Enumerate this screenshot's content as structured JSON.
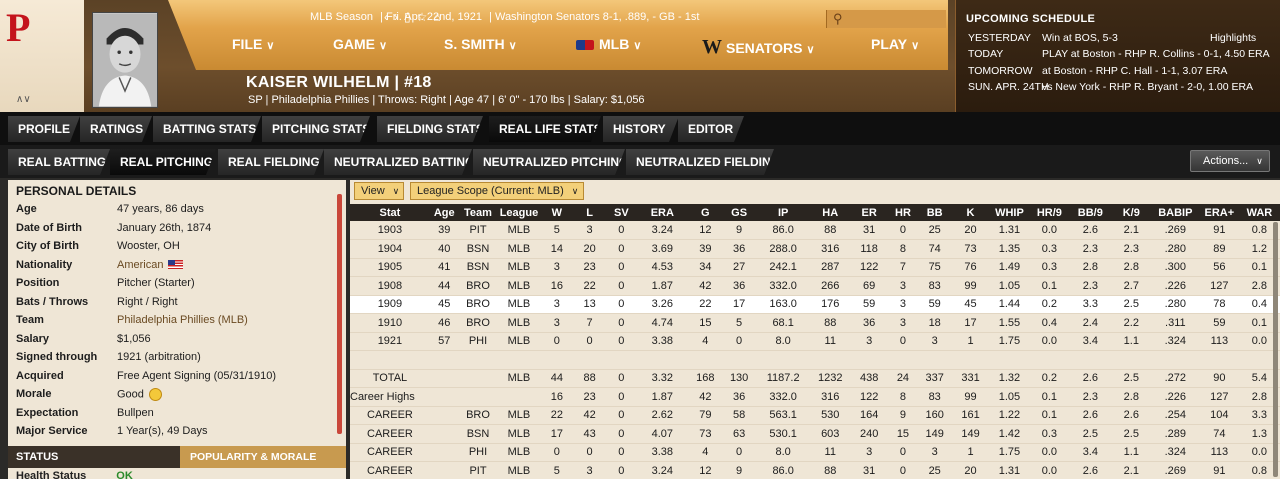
{
  "header": {
    "season": "MLB Season",
    "date": "Fri. Apr. 22nd, 1921",
    "team_record": "Washington Senators  8-1, .889, - GB - 1st",
    "menu": [
      {
        "label": "FILE"
      },
      {
        "label": "GAME"
      },
      {
        "label": "S. SMITH"
      },
      {
        "label": "MLB"
      },
      {
        "label": "SENATORS"
      },
      {
        "label": "PLAY"
      }
    ],
    "player_name": "KAISER WILHELM  |  #18",
    "player_info": "SP | Philadelphia Phillies  |  Throws: Right  |  Age 47  |  6' 0\" - 170 lbs  |  Salary: $1,056"
  },
  "schedule": {
    "title": "UPCOMING SCHEDULE",
    "rows": [
      {
        "day": "YESTERDAY",
        "text": "Win at BOS, 5-3",
        "extra": "Highlights"
      },
      {
        "day": "TODAY",
        "text": "PLAY at Boston - RHP R. Collins - 0-1, 4.50 ERA",
        "extra": ""
      },
      {
        "day": "TOMORROW",
        "text": "at Boston - RHP C. Hall - 1-1, 3.07 ERA",
        "extra": ""
      },
      {
        "day": "SUN. APR. 24TH",
        "text": "vs New York - RHP R. Bryant - 2-0, 1.00 ERA",
        "extra": ""
      }
    ]
  },
  "tabs_main": [
    "PROFILE",
    "RATINGS",
    "BATTING STATS",
    "PITCHING STATS",
    "FIELDING STATS",
    "REAL LIFE STATS",
    "HISTORY",
    "EDITOR"
  ],
  "tabs_sub": [
    "REAL BATTING",
    "REAL PITCHING",
    "REAL FIELDING",
    "NEUTRALIZED BATTING",
    "NEUTRALIZED PITCHING",
    "NEUTRALIZED FIELDING"
  ],
  "actions_label": "Actions...",
  "personal": {
    "title": "PERSONAL DETAILS",
    "rows": [
      {
        "label": "Age",
        "value": "47 years, 86 days"
      },
      {
        "label": "Date of Birth",
        "value": "January 26th, 1874"
      },
      {
        "label": "City of Birth",
        "value": "Wooster, OH"
      },
      {
        "label": "Nationality",
        "value": "American"
      },
      {
        "label": "Position",
        "value": "Pitcher (Starter)"
      },
      {
        "label": "Bats / Throws",
        "value": "Right / Right"
      },
      {
        "label": "Team",
        "value": "Philadelphia Phillies (MLB)"
      },
      {
        "label": "Salary",
        "value": "$1,056"
      },
      {
        "label": "Signed through",
        "value": "1921 (arbitration)"
      },
      {
        "label": "Acquired",
        "value": "Free Agent Signing (05/31/1910)"
      },
      {
        "label": "Morale",
        "value": "Good"
      },
      {
        "label": "Expectation",
        "value": "Bullpen"
      },
      {
        "label": "Major Service",
        "value": "1 Year(s), 49 Days"
      }
    ],
    "status_title": "STATUS",
    "popularity_tab": "POPULARITY & MORALE",
    "health_label": "Health Status",
    "health_value": "OK"
  },
  "filters": {
    "view": "View",
    "scope": "League Scope (Current: MLB)"
  },
  "table": {
    "headers": [
      "Stat",
      "Age",
      "Team",
      "League",
      "W",
      "L",
      "SV",
      "ERA",
      "G",
      "GS",
      "IP",
      "HA",
      "ER",
      "HR",
      "BB",
      "K",
      "WHIP",
      "HR/9",
      "BB/9",
      "K/9",
      "BABIP",
      "ERA+",
      "WAR"
    ],
    "rows": [
      [
        "1903",
        "39",
        "PIT",
        "MLB",
        "5",
        "3",
        "0",
        "3.24",
        "12",
        "9",
        "86.0",
        "88",
        "31",
        "0",
        "25",
        "20",
        "1.31",
        "0.0",
        "2.6",
        "2.1",
        ".269",
        "91",
        "0.8"
      ],
      [
        "1904",
        "40",
        "BSN",
        "MLB",
        "14",
        "20",
        "0",
        "3.69",
        "39",
        "36",
        "288.0",
        "316",
        "118",
        "8",
        "74",
        "73",
        "1.35",
        "0.3",
        "2.3",
        "2.3",
        ".280",
        "89",
        "1.2"
      ],
      [
        "1905",
        "41",
        "BSN",
        "MLB",
        "3",
        "23",
        "0",
        "4.53",
        "34",
        "27",
        "242.1",
        "287",
        "122",
        "7",
        "75",
        "76",
        "1.49",
        "0.3",
        "2.8",
        "2.8",
        ".300",
        "56",
        "0.1"
      ],
      [
        "1908",
        "44",
        "BRO",
        "MLB",
        "16",
        "22",
        "0",
        "1.87",
        "42",
        "36",
        "332.0",
        "266",
        "69",
        "3",
        "83",
        "99",
        "1.05",
        "0.1",
        "2.3",
        "2.7",
        ".226",
        "127",
        "2.8"
      ],
      [
        "1909",
        "45",
        "BRO",
        "MLB",
        "3",
        "13",
        "0",
        "3.26",
        "22",
        "17",
        "163.0",
        "176",
        "59",
        "3",
        "59",
        "45",
        "1.44",
        "0.2",
        "3.3",
        "2.5",
        ".280",
        "78",
        "0.4"
      ],
      [
        "1910",
        "46",
        "BRO",
        "MLB",
        "3",
        "7",
        "0",
        "4.74",
        "15",
        "5",
        "68.1",
        "88",
        "36",
        "3",
        "18",
        "17",
        "1.55",
        "0.4",
        "2.4",
        "2.2",
        ".311",
        "59",
        "0.1"
      ],
      [
        "1921",
        "57",
        "PHI",
        "MLB",
        "0",
        "0",
        "0",
        "3.38",
        "4",
        "0",
        "8.0",
        "11",
        "3",
        "0",
        "3",
        "1",
        "1.75",
        "0.0",
        "3.4",
        "1.1",
        ".324",
        "113",
        "0.0"
      ],
      [
        "",
        "",
        "",
        "",
        "",
        "",
        "",
        "",
        "",
        "",
        "",
        "",
        "",
        "",
        "",
        "",
        "",
        "",
        "",
        "",
        "",
        "",
        ""
      ],
      [
        "TOTAL",
        "",
        "",
        "MLB",
        "44",
        "88",
        "0",
        "3.32",
        "168",
        "130",
        "1187.2",
        "1232",
        "438",
        "24",
        "337",
        "331",
        "1.32",
        "0.2",
        "2.6",
        "2.5",
        ".272",
        "90",
        "5.4"
      ],
      [
        "Career Highs",
        "",
        "",
        "",
        "16",
        "23",
        "0",
        "1.87",
        "42",
        "36",
        "332.0",
        "316",
        "122",
        "8",
        "83",
        "99",
        "1.05",
        "0.1",
        "2.3",
        "2.8",
        ".226",
        "127",
        "2.8"
      ],
      [
        "CAREER",
        "",
        "BRO",
        "MLB",
        "22",
        "42",
        "0",
        "2.62",
        "79",
        "58",
        "563.1",
        "530",
        "164",
        "9",
        "160",
        "161",
        "1.22",
        "0.1",
        "2.6",
        "2.6",
        ".254",
        "104",
        "3.3"
      ],
      [
        "CAREER",
        "",
        "BSN",
        "MLB",
        "17",
        "43",
        "0",
        "4.07",
        "73",
        "63",
        "530.1",
        "603",
        "240",
        "15",
        "149",
        "149",
        "1.42",
        "0.3",
        "2.5",
        "2.5",
        ".289",
        "74",
        "1.3"
      ],
      [
        "CAREER",
        "",
        "PHI",
        "MLB",
        "0",
        "0",
        "0",
        "3.38",
        "4",
        "0",
        "8.0",
        "11",
        "3",
        "0",
        "3",
        "1",
        "1.75",
        "0.0",
        "3.4",
        "1.1",
        ".324",
        "113",
        "0.0"
      ],
      [
        "CAREER",
        "",
        "PIT",
        "MLB",
        "5",
        "3",
        "0",
        "3.24",
        "12",
        "9",
        "86.0",
        "88",
        "31",
        "0",
        "25",
        "20",
        "1.31",
        "0.0",
        "2.6",
        "2.1",
        ".269",
        "91",
        "0.8"
      ]
    ]
  }
}
